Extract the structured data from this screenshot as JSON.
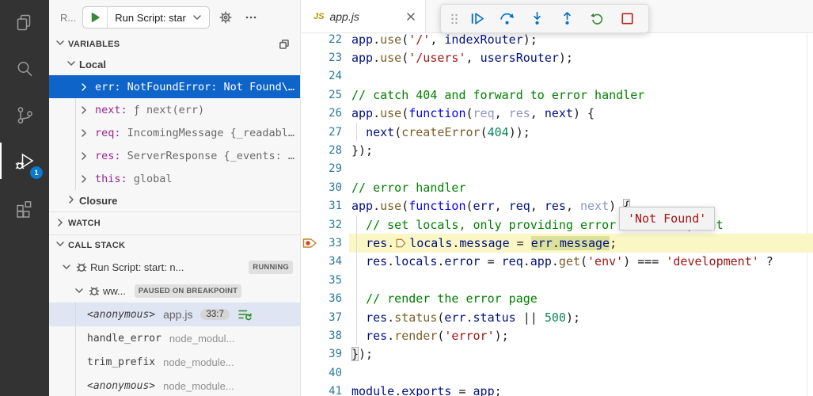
{
  "colors": {
    "selection_blue": "#0e64c8",
    "activity_badge_blue": "#0a79ce",
    "debug_icon_blue": "#0273c4",
    "restart_green": "#388a34",
    "stop_red": "#b3261e",
    "string_red": "#a31515",
    "comment_green": "#008000",
    "keyword_blue": "#0000ff",
    "variable_navy": "#001080",
    "function_brown": "#795E26",
    "number_green": "#098658",
    "current_line_yellow": "#fbf7c4",
    "breakpoint_red": "#e03a32"
  },
  "activity_bar": {
    "items": [
      {
        "name": "explorer",
        "active": false
      },
      {
        "name": "search",
        "active": false
      },
      {
        "name": "source-control",
        "active": false
      },
      {
        "name": "run-and-debug",
        "active": true,
        "badge": "1"
      },
      {
        "name": "extensions",
        "active": false
      }
    ]
  },
  "sidebar": {
    "header": {
      "title_truncated": "R...",
      "run_config": "Run Script: star"
    },
    "variables": {
      "title": "VARIABLES",
      "local_label": "Local",
      "items": [
        {
          "name": "err",
          "value": "NotFoundError: Not Found\\…",
          "selected": true
        },
        {
          "name": "next",
          "value": "ƒ next(err)",
          "selected": false
        },
        {
          "name": "req",
          "value": "IncomingMessage {_readabl…",
          "selected": false
        },
        {
          "name": "res",
          "value": "ServerResponse {_events: …",
          "selected": false
        },
        {
          "name": "this",
          "value": "global",
          "selected": false
        }
      ],
      "closure_label": "Closure"
    },
    "watch": {
      "title": "WATCH"
    },
    "call_stack": {
      "title": "CALL STACK",
      "sessions": [
        {
          "label": "Run Script: start: n...",
          "badge": "RUNNING",
          "indent": 0
        },
        {
          "label": "ww...",
          "badge": "PAUSED ON BREAKPOINT",
          "indent": 1
        }
      ],
      "frames": [
        {
          "fn": "<anonymous>",
          "file": "app.js",
          "loc": "33:7",
          "focused": true,
          "selected": true
        },
        {
          "fn": "handle_error",
          "file": "node_modul...",
          "loc": "",
          "focused": false,
          "selected": false
        },
        {
          "fn": "trim_prefix",
          "file": "node_module...",
          "loc": "",
          "focused": false,
          "selected": false
        },
        {
          "fn": "<anonymous>",
          "file": "node_module...",
          "loc": "",
          "focused": false,
          "selected": false
        }
      ]
    }
  },
  "editor": {
    "tab": {
      "type_label": "JS",
      "name": "app.js"
    },
    "toolbar": {
      "buttons": [
        "continue",
        "step-over",
        "step-into",
        "step-out",
        "restart",
        "stop"
      ]
    },
    "tooltip": {
      "text": "'Not Found'"
    },
    "breakpoint_line": 33,
    "current_line": 33,
    "lines": [
      {
        "n": 22,
        "tokens": [
          {
            "t": "app",
            "c": "nv"
          },
          {
            "t": ".",
            "c": "pn"
          },
          {
            "t": "use",
            "c": "fn"
          },
          {
            "t": "(",
            "c": "pn"
          },
          {
            "t": "'/'",
            "c": "st"
          },
          {
            "t": ", ",
            "c": "pn"
          },
          {
            "t": "indexRouter",
            "c": "nv"
          },
          {
            "t": ");",
            "c": "pn"
          }
        ]
      },
      {
        "n": 23,
        "tokens": [
          {
            "t": "app",
            "c": "nv"
          },
          {
            "t": ".",
            "c": "pn"
          },
          {
            "t": "use",
            "c": "fn"
          },
          {
            "t": "(",
            "c": "pn"
          },
          {
            "t": "'/users'",
            "c": "st"
          },
          {
            "t": ", ",
            "c": "pn"
          },
          {
            "t": "usersRouter",
            "c": "nv"
          },
          {
            "t": ");",
            "c": "pn"
          }
        ]
      },
      {
        "n": 24,
        "tokens": []
      },
      {
        "n": 25,
        "tokens": [
          {
            "t": "// catch 404 and forward to error handler",
            "c": "cm"
          }
        ]
      },
      {
        "n": 26,
        "tokens": [
          {
            "t": "app",
            "c": "nv"
          },
          {
            "t": ".",
            "c": "pn"
          },
          {
            "t": "use",
            "c": "fn"
          },
          {
            "t": "(",
            "c": "pn"
          },
          {
            "t": "function",
            "c": "kw"
          },
          {
            "t": "(",
            "c": "pn"
          },
          {
            "t": "req",
            "c": "dm"
          },
          {
            "t": ", ",
            "c": "pn"
          },
          {
            "t": "res",
            "c": "dm"
          },
          {
            "t": ", ",
            "c": "pn"
          },
          {
            "t": "next",
            "c": "nv"
          },
          {
            "t": ") {",
            "c": "pn"
          }
        ]
      },
      {
        "n": 27,
        "guide": true,
        "tokens": [
          {
            "t": "  ",
            "c": "pn"
          },
          {
            "t": "next",
            "c": "nv"
          },
          {
            "t": "(",
            "c": "pn"
          },
          {
            "t": "createError",
            "c": "fn"
          },
          {
            "t": "(",
            "c": "pn"
          },
          {
            "t": "404",
            "c": "nm"
          },
          {
            "t": "));",
            "c": "pn"
          }
        ]
      },
      {
        "n": 28,
        "tokens": [
          {
            "t": "});",
            "c": "pn"
          }
        ]
      },
      {
        "n": 29,
        "tokens": []
      },
      {
        "n": 30,
        "tokens": [
          {
            "t": "// error handler",
            "c": "cm"
          }
        ]
      },
      {
        "n": 31,
        "tokens": [
          {
            "t": "app",
            "c": "nv"
          },
          {
            "t": ".",
            "c": "pn"
          },
          {
            "t": "use",
            "c": "fn"
          },
          {
            "t": "(",
            "c": "pn"
          },
          {
            "t": "function",
            "c": "kw"
          },
          {
            "t": "(",
            "c": "pn"
          },
          {
            "t": "err",
            "c": "nv"
          },
          {
            "t": ", ",
            "c": "pn"
          },
          {
            "t": "req",
            "c": "nv"
          },
          {
            "t": ", ",
            "c": "pn"
          },
          {
            "t": "res",
            "c": "nv"
          },
          {
            "t": ", ",
            "c": "pn"
          },
          {
            "t": "next",
            "c": "dm"
          },
          {
            "t": ") ",
            "c": "pn"
          },
          {
            "t": "{",
            "c": "pn",
            "box": true
          }
        ]
      },
      {
        "n": 32,
        "guide": true,
        "tokens": [
          {
            "t": "  ",
            "c": "pn"
          },
          {
            "t": "// set locals, only providing error in development",
            "c": "cm"
          }
        ]
      },
      {
        "n": 33,
        "guide": true,
        "current": true,
        "breakpoint": true,
        "tokens": [
          {
            "t": "  ",
            "c": "pn"
          },
          {
            "t": "res",
            "c": "nv"
          },
          {
            "t": ".",
            "c": "pn"
          },
          {
            "marker": "inline-breakpoint"
          },
          {
            "t": "locals",
            "c": "nv"
          },
          {
            "t": ".",
            "c": "pn"
          },
          {
            "t": "message",
            "c": "nv"
          },
          {
            "t": " = ",
            "c": "pn"
          },
          {
            "t": "err",
            "c": "nv",
            "hl": true
          },
          {
            "t": ".",
            "c": "pn",
            "hl": true
          },
          {
            "t": "message",
            "c": "nv",
            "hl": true
          },
          {
            "t": ";",
            "c": "pn"
          }
        ]
      },
      {
        "n": 34,
        "guide": true,
        "tokens": [
          {
            "t": "  ",
            "c": "pn"
          },
          {
            "t": "res",
            "c": "nv"
          },
          {
            "t": ".",
            "c": "pn"
          },
          {
            "t": "locals",
            "c": "nv"
          },
          {
            "t": ".",
            "c": "pn"
          },
          {
            "t": "error",
            "c": "nv"
          },
          {
            "t": " = ",
            "c": "pn"
          },
          {
            "t": "req",
            "c": "nv"
          },
          {
            "t": ".",
            "c": "pn"
          },
          {
            "t": "app",
            "c": "nv"
          },
          {
            "t": ".",
            "c": "pn"
          },
          {
            "t": "get",
            "c": "fn"
          },
          {
            "t": "(",
            "c": "pn"
          },
          {
            "t": "'env'",
            "c": "st"
          },
          {
            "t": ") ",
            "c": "pn"
          },
          {
            "t": "=== ",
            "c": "pn"
          },
          {
            "t": "'development'",
            "c": "st"
          },
          {
            "t": " ?",
            "c": "pn"
          }
        ]
      },
      {
        "n": 35,
        "guide": true,
        "tokens": []
      },
      {
        "n": 36,
        "guide": true,
        "tokens": [
          {
            "t": "  ",
            "c": "pn"
          },
          {
            "t": "// render the error page",
            "c": "cm"
          }
        ]
      },
      {
        "n": 37,
        "guide": true,
        "tokens": [
          {
            "t": "  ",
            "c": "pn"
          },
          {
            "t": "res",
            "c": "nv"
          },
          {
            "t": ".",
            "c": "pn"
          },
          {
            "t": "status",
            "c": "fn"
          },
          {
            "t": "(",
            "c": "pn"
          },
          {
            "t": "err",
            "c": "nv"
          },
          {
            "t": ".",
            "c": "pn"
          },
          {
            "t": "status",
            "c": "nv"
          },
          {
            "t": " || ",
            "c": "pn"
          },
          {
            "t": "500",
            "c": "nm"
          },
          {
            "t": ");",
            "c": "pn"
          }
        ]
      },
      {
        "n": 38,
        "guide": true,
        "tokens": [
          {
            "t": "  ",
            "c": "pn"
          },
          {
            "t": "res",
            "c": "nv"
          },
          {
            "t": ".",
            "c": "pn"
          },
          {
            "t": "render",
            "c": "fn"
          },
          {
            "t": "(",
            "c": "pn"
          },
          {
            "t": "'error'",
            "c": "st"
          },
          {
            "t": ");",
            "c": "pn"
          }
        ]
      },
      {
        "n": 39,
        "tokens": [
          {
            "t": "}",
            "c": "pn",
            "box": true
          },
          {
            "t": ");",
            "c": "pn"
          }
        ]
      },
      {
        "n": 40,
        "tokens": []
      },
      {
        "n": 41,
        "tokens": [
          {
            "t": "module",
            "c": "nv"
          },
          {
            "t": ".",
            "c": "pn"
          },
          {
            "t": "exports",
            "c": "nv"
          },
          {
            "t": " = ",
            "c": "pn"
          },
          {
            "t": "app",
            "c": "nv"
          },
          {
            "t": ";",
            "c": "pn"
          }
        ]
      }
    ]
  }
}
